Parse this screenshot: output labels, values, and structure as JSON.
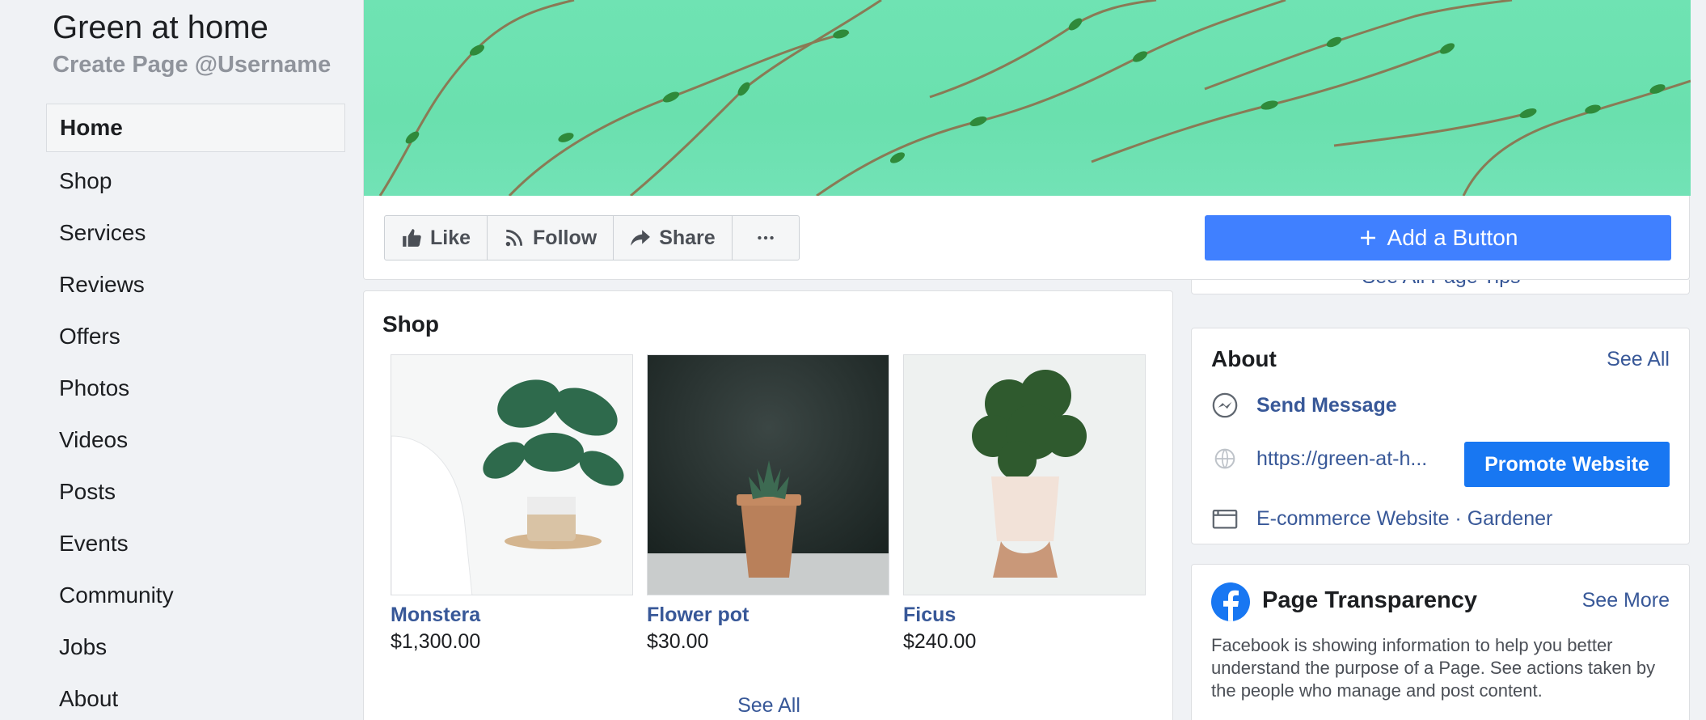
{
  "page": {
    "title": "Green at home",
    "handle": "Create Page @Username"
  },
  "nav": {
    "items": [
      {
        "label": "Home",
        "active": true
      },
      {
        "label": "Shop"
      },
      {
        "label": "Services"
      },
      {
        "label": "Reviews"
      },
      {
        "label": "Offers"
      },
      {
        "label": "Photos"
      },
      {
        "label": "Videos"
      },
      {
        "label": "Posts"
      },
      {
        "label": "Events"
      },
      {
        "label": "Community"
      },
      {
        "label": "Jobs"
      },
      {
        "label": "About"
      }
    ]
  },
  "actions": {
    "like": "Like",
    "follow": "Follow",
    "share": "Share",
    "more_icon": "ellipsis-icon",
    "add_button": "Add a Button"
  },
  "shop": {
    "title": "Shop",
    "products": [
      {
        "name": "Monstera",
        "price": "$1,300.00"
      },
      {
        "name": "Flower pot",
        "price": "$30.00"
      },
      {
        "name": "Ficus",
        "price": "$240.00"
      }
    ],
    "see_all": "See All"
  },
  "tips": {
    "link": "See All Page Tips"
  },
  "about": {
    "title": "About",
    "see_all": "See All",
    "send_message": "Send Message",
    "website": "https://green-at-h...",
    "promote": "Promote Website",
    "categories": "E-commerce Website · Gardener"
  },
  "transparency": {
    "title": "Page Transparency",
    "see_more": "See More",
    "description": "Facebook is showing information to help you better understand the purpose of a Page. See actions taken by the people who manage and post content."
  },
  "colors": {
    "accent": "#4080ff",
    "link": "#385898",
    "promote": "#1877f2",
    "cover": "#6fe3b3"
  }
}
